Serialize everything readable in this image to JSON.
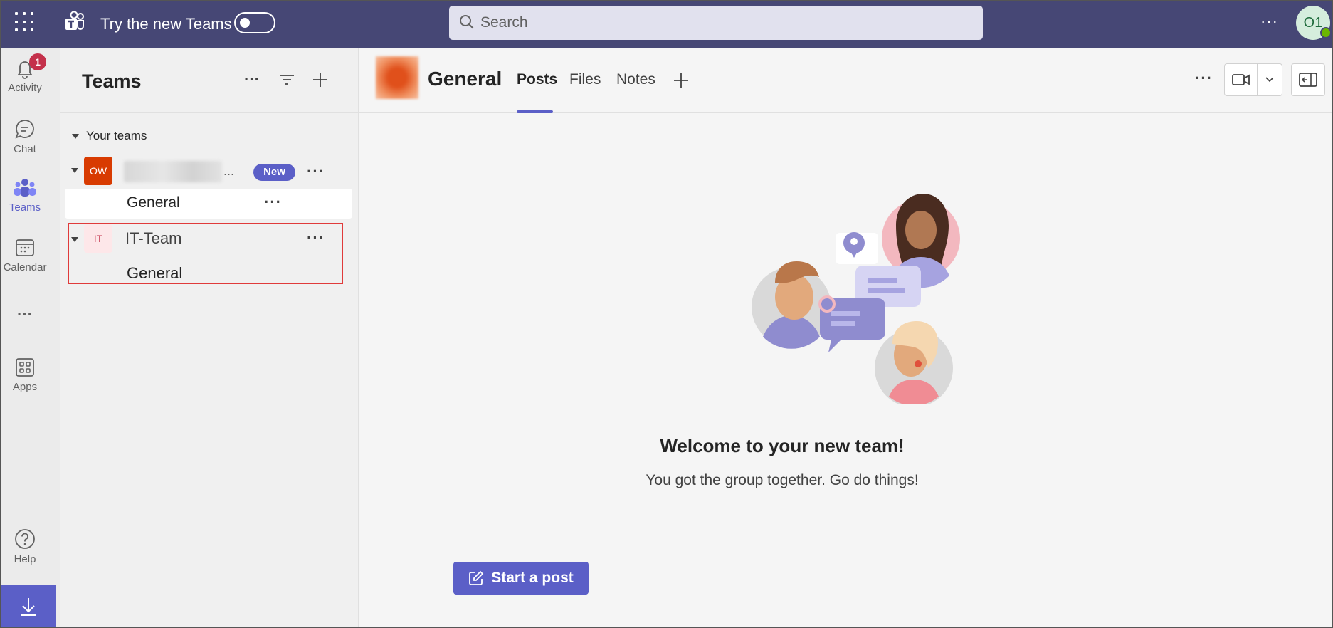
{
  "topbar": {
    "try_new_label": "Try the new Teams",
    "search_placeholder": "Search",
    "more_label": "···",
    "avatar_initials": "O1",
    "bg_color": "#464775"
  },
  "rail": {
    "items": [
      {
        "label": "Activity",
        "icon": "bell-icon",
        "badge": "1"
      },
      {
        "label": "Chat",
        "icon": "chat-icon"
      },
      {
        "label": "Teams",
        "icon": "teams-icon",
        "active": true
      },
      {
        "label": "Calendar",
        "icon": "calendar-icon"
      },
      {
        "label": "···",
        "icon": "more-apps-icon"
      },
      {
        "label": "Apps",
        "icon": "apps-icon"
      },
      {
        "label": "Help",
        "icon": "help-icon"
      }
    ],
    "download_icon": "download-icon"
  },
  "teams_panel": {
    "title": "Teams",
    "section_label": "Your teams",
    "teams": [
      {
        "avatar_text": "OW",
        "avatar_color": "#d83b01",
        "name_suffix": "...",
        "badge": "New",
        "channels": [
          {
            "name": "General"
          }
        ]
      },
      {
        "avatar_text": "IT",
        "avatar_color": "#fde7e9",
        "name": "IT-Team",
        "channels": [
          {
            "name": "General"
          }
        ]
      }
    ],
    "dots": "···"
  },
  "channel": {
    "title": "General",
    "tabs": [
      {
        "label": "Posts",
        "active": true
      },
      {
        "label": "Files"
      },
      {
        "label": "Notes"
      }
    ],
    "accent_color": "#5b5fc7"
  },
  "welcome": {
    "title": "Welcome to your new team!",
    "subtitle": "You got the group together. Go do things!"
  },
  "actions": {
    "start_post_label": "Start a post"
  }
}
